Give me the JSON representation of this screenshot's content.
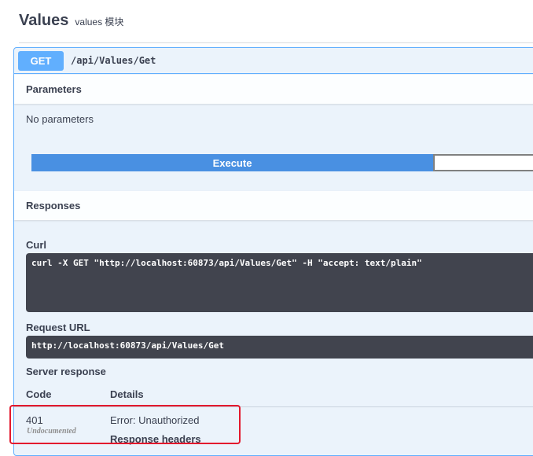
{
  "tag": {
    "title": "Values",
    "description": "values 模块"
  },
  "operation": {
    "method": "GET",
    "path": "/api/Values/Get"
  },
  "parameters": {
    "header": "Parameters",
    "empty_text": "No parameters"
  },
  "execute": {
    "label": "Execute"
  },
  "responses": {
    "header": "Responses",
    "curl_label": "Curl",
    "curl_value": "curl -X GET \"http://localhost:60873/api/Values/Get\" -H \"accept: text/plain\"",
    "request_url_label": "Request URL",
    "request_url_value": "http://localhost:60873/api/Values/Get",
    "server_response_label": "Server response",
    "col_code": "Code",
    "col_details": "Details",
    "row": {
      "code": "401",
      "code_note": "Undocumented",
      "details": "Error: Unauthorized",
      "headers_label": "Response headers"
    }
  },
  "colors": {
    "get_accent": "#61affe",
    "execute_blue": "#4990e2",
    "code_bg": "#41444e",
    "highlight_red": "#e3182d"
  }
}
